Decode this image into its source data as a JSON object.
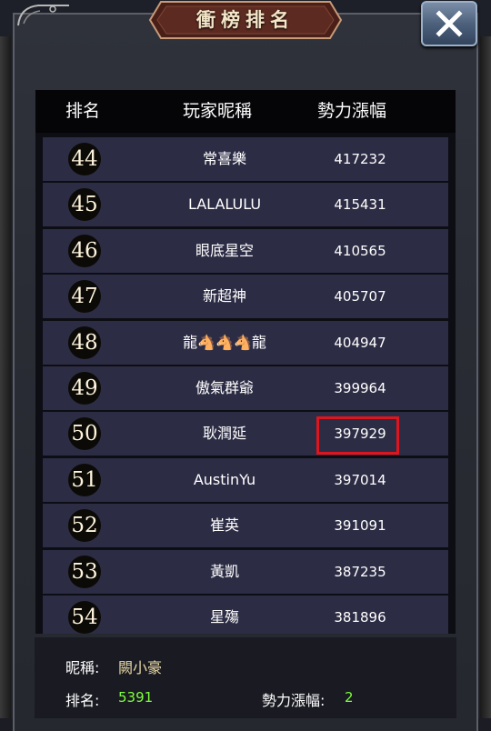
{
  "title": "衝榜排名",
  "close_icon": "close-x-icon",
  "columns": {
    "rank": "排名",
    "nickname": "玩家昵稱",
    "power_gain": "勢力漲幅"
  },
  "rows": [
    {
      "rank": "44",
      "name": "常喜樂",
      "power": "417232"
    },
    {
      "rank": "45",
      "name": "LALALULU",
      "power": "415431"
    },
    {
      "rank": "46",
      "name": "眼底星空",
      "power": "410565"
    },
    {
      "rank": "47",
      "name": "新超神",
      "power": "405707"
    },
    {
      "rank": "48",
      "name": "龍🐴🐴🐴龍",
      "power": "404947"
    },
    {
      "rank": "49",
      "name": "傲氣群爺",
      "power": "399964"
    },
    {
      "rank": "50",
      "name": "耿潤延",
      "power": "397929",
      "highlighted": true
    },
    {
      "rank": "51",
      "name": "AustinYu",
      "power": "397014"
    },
    {
      "rank": "52",
      "name": "崔英",
      "power": "391091"
    },
    {
      "rank": "53",
      "name": "黃凱",
      "power": "387235"
    },
    {
      "rank": "54",
      "name": "星殤",
      "power": "381896"
    }
  ],
  "footer": {
    "nickname_label": "昵稱:",
    "nickname_value": "闕小豪",
    "rank_label": "排名:",
    "rank_value": "5391",
    "power_label": "勢力漲幅:",
    "power_value": "2"
  },
  "colors": {
    "highlight_border": "#e0141c",
    "value_green": "#7dff3c",
    "name_gold": "#e8d9a8"
  }
}
